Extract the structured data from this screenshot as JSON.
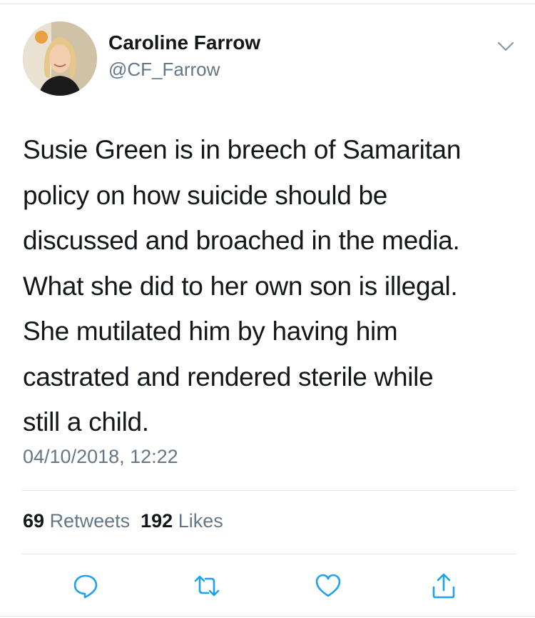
{
  "tweet": {
    "author": {
      "name": "Caroline Farrow",
      "handle": "@CF_Farrow"
    },
    "text_lines": [
      "Susie Green is in breech of Samaritan",
      "policy on how suicide should be",
      "discussed and broached in the media.",
      "What she did to her own son is illegal.",
      "She mutilated him by having him",
      "castrated and rendered sterile while",
      "still a child."
    ],
    "timestamp": "04/10/2018, 12:22",
    "stats": {
      "retweets_count": "69",
      "retweets_label": "Retweets",
      "likes_count": "192",
      "likes_label": "Likes"
    },
    "actions": {
      "reply_icon": "reply-icon",
      "retweet_icon": "retweet-icon",
      "like_icon": "heart-icon",
      "share_icon": "share-icon"
    },
    "colors": {
      "text": "#14171a",
      "secondary": "#657786",
      "icon": "#1da1f2",
      "divider": "#e1e8ed"
    }
  }
}
